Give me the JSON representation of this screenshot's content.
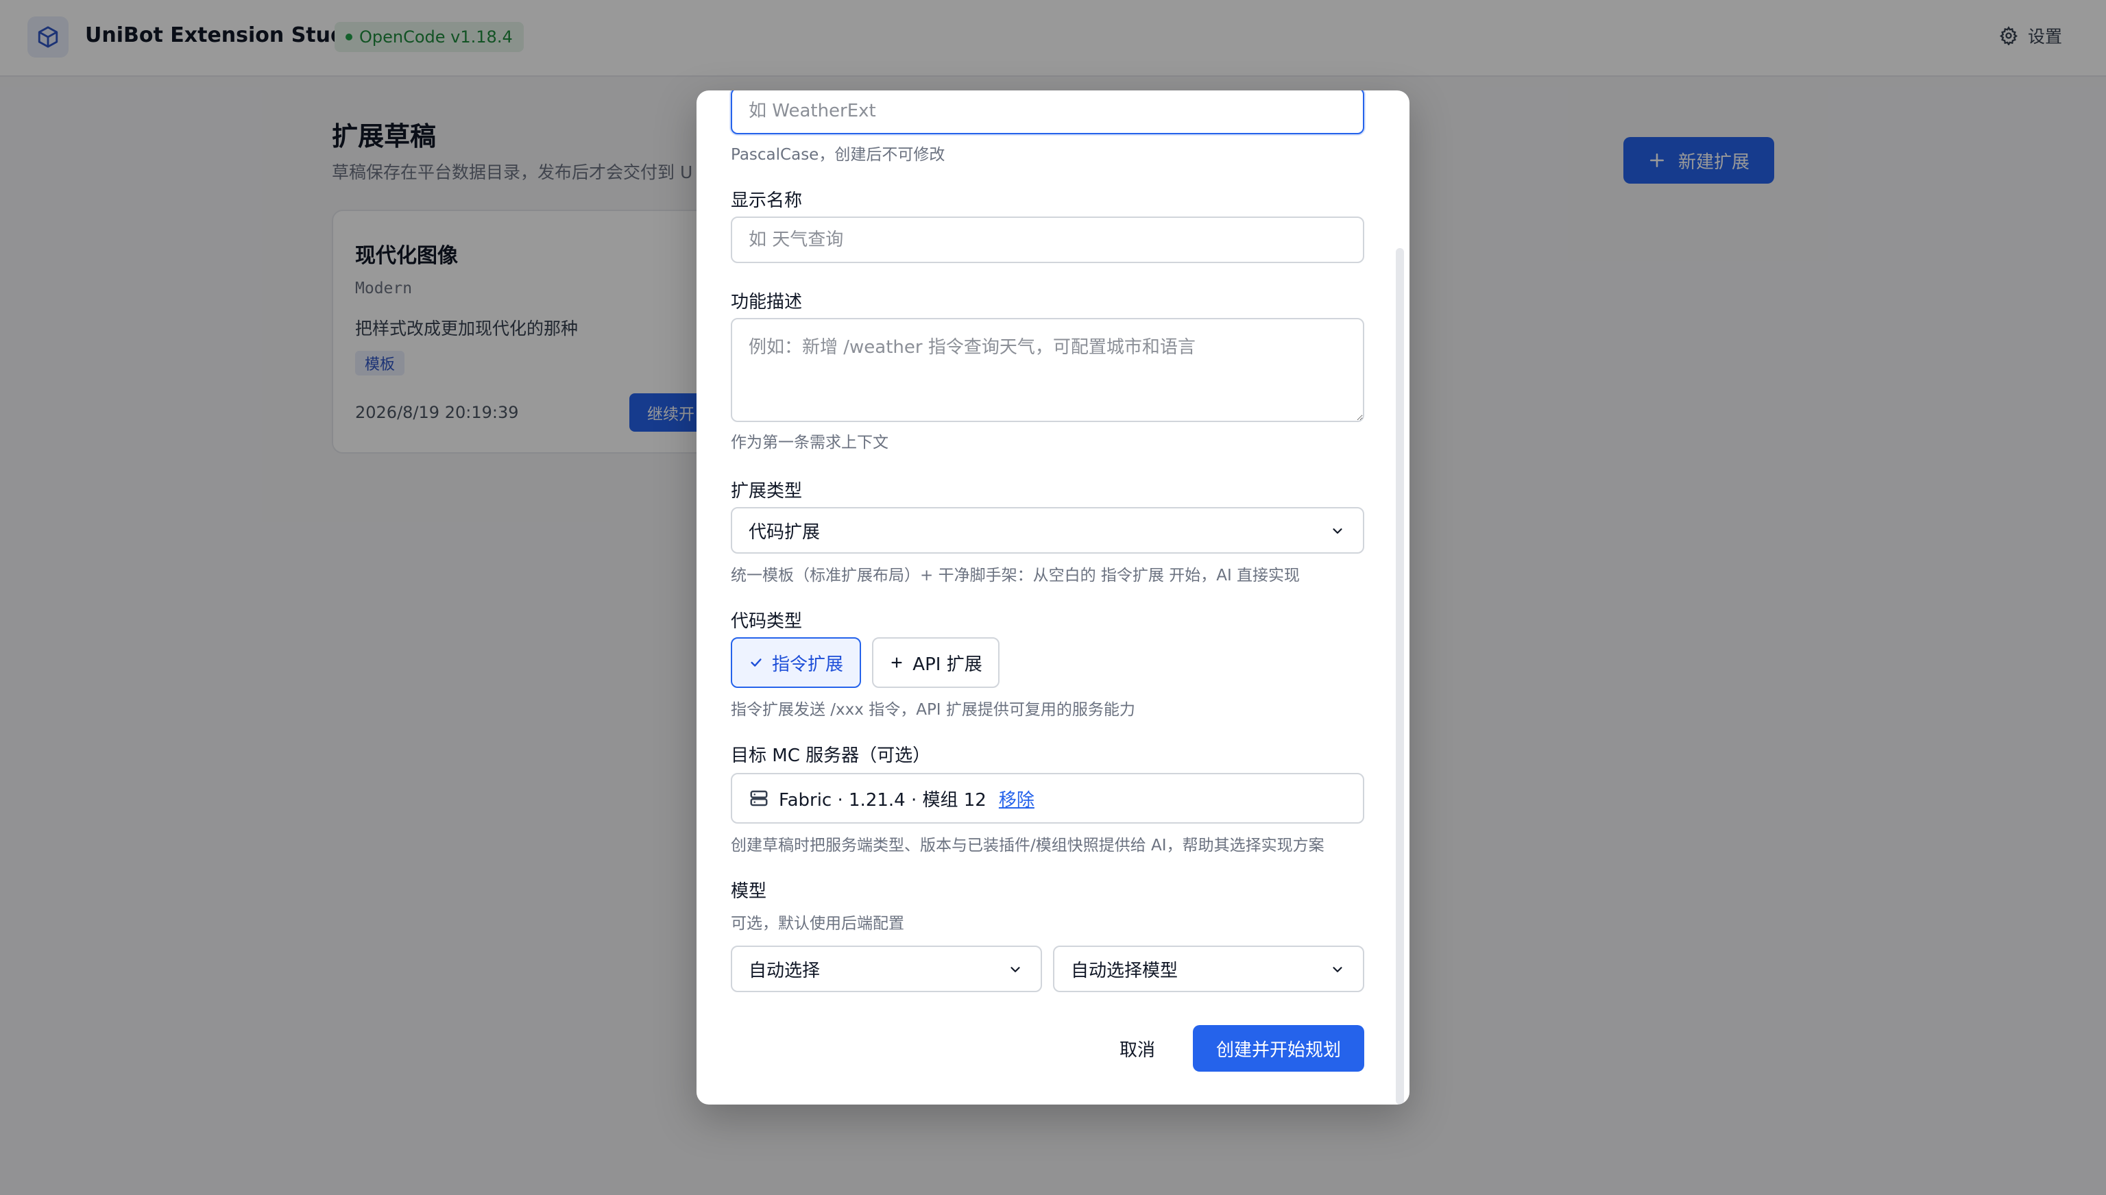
{
  "header": {
    "app_title": "UniBot Extension Studio",
    "version_badge": "OpenCode v1.18.4",
    "settings_label": "设置"
  },
  "page": {
    "title": "扩展草稿",
    "subtitle": "草稿保存在平台数据目录，发布后才会交付到 U",
    "new_extension_label": "新建扩展"
  },
  "draft_card": {
    "title": "现代化图像",
    "code_name": "Modern",
    "description": "把样式改成更加现代化的那种",
    "tag": "模板",
    "timestamp": "2026/8/19 20:19:39",
    "continue_label": "继续开"
  },
  "modal": {
    "name_field": {
      "placeholder": "如 WeatherExt",
      "hint": "PascalCase，创建后不可修改"
    },
    "display_name": {
      "label": "显示名称",
      "placeholder": "如 天气查询"
    },
    "description": {
      "label": "功能描述",
      "placeholder": "例如：新增 /weather 指令查询天气，可配置城市和语言",
      "hint": "作为第一条需求上下文"
    },
    "extension_type": {
      "label": "扩展类型",
      "selected": "代码扩展",
      "hint": "统一模板（标准扩展布局）+ 干净脚手架：从空白的 指令扩展 开始，AI 直接实现"
    },
    "code_type": {
      "label": "代码类型",
      "options": [
        "指令扩展",
        "API 扩展"
      ],
      "selected_index": 0,
      "hint": "指令扩展发送 /xxx 指令，API 扩展提供可复用的服务能力"
    },
    "target_server": {
      "label": "目标 MC 服务器（可选）",
      "value": "Fabric · 1.21.4 · 模组 12",
      "remove_label": "移除",
      "hint": "创建草稿时把服务端类型、版本与已装插件/模组快照提供给 AI，帮助其选择实现方案"
    },
    "model": {
      "label": "模型",
      "hint": "可选，默认使用后端配置",
      "provider_selected": "自动选择",
      "model_selected": "自动选择模型"
    },
    "cancel_label": "取消",
    "submit_label": "创建并开始规划"
  },
  "colors": {
    "accent": "#2563eb",
    "badge_green": "#1f8a3d",
    "overlay": "rgba(0,0,0,0.4)"
  }
}
